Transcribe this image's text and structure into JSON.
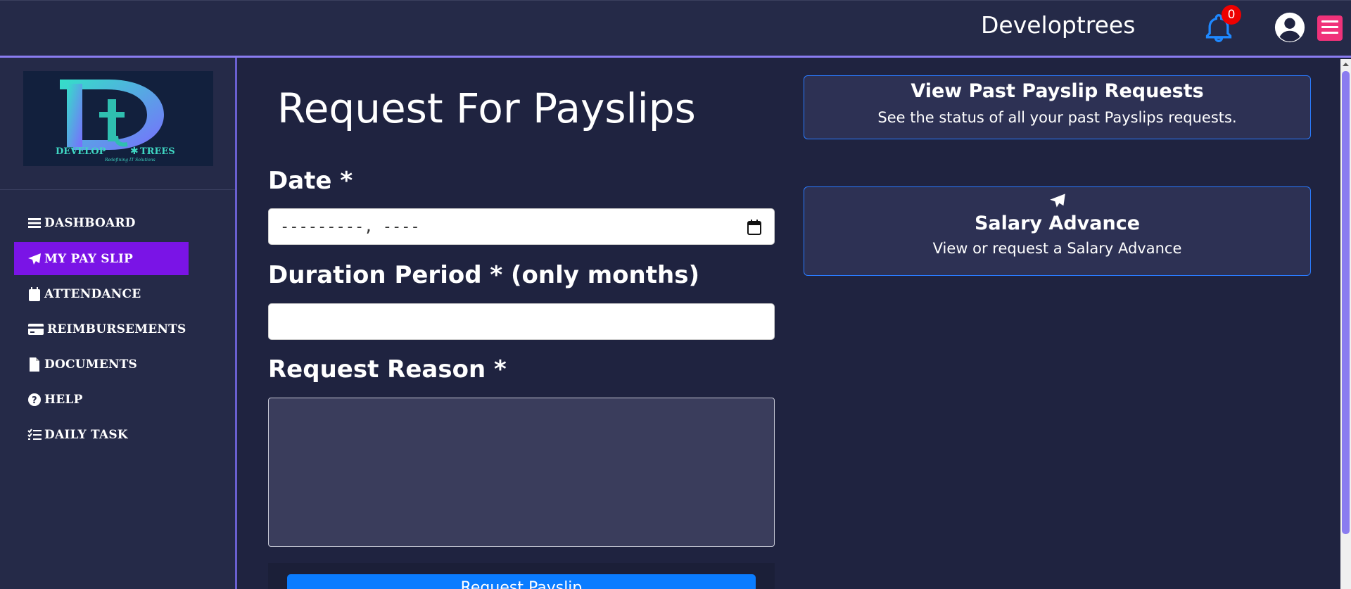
{
  "header": {
    "brand": "Developtrees",
    "notification_count": "0"
  },
  "sidebar": {
    "logo_text": "DEVELOPTREES",
    "logo_tagline": "Redefining IT Solutions",
    "items": [
      {
        "label": "DASHBOARD",
        "icon": "bars-icon"
      },
      {
        "label": "MY PAY SLIP",
        "icon": "paper-plane-icon",
        "active": true
      },
      {
        "label": "ATTENDANCE",
        "icon": "calendar-icon"
      },
      {
        "label": "REIMBURSEMENTS",
        "icon": "credit-card-icon"
      },
      {
        "label": "DOCUMENTS",
        "icon": "file-icon"
      },
      {
        "label": "HELP",
        "icon": "question-circle-icon"
      },
      {
        "label": "DAILY TASK",
        "icon": "list-check-icon"
      }
    ]
  },
  "main": {
    "title": "Request For Payslips",
    "date_label": "Date *",
    "date_placeholder": "---------, ----",
    "duration_label": "Duration Period * (only months)",
    "duration_value": "",
    "reason_label": "Request Reason *",
    "reason_value": "",
    "submit_label": "Request Payslip"
  },
  "cards": {
    "past": {
      "title": "View Past Payslip Requests",
      "desc": "See the status of all your past Payslips requests."
    },
    "advance": {
      "title": "Salary Advance",
      "desc": "View or request a Salary Advance"
    }
  },
  "colors": {
    "background": "#1f2340",
    "panel": "#252a48",
    "accent": "#7a14e6",
    "card_border": "#2a7bff",
    "button": "#0a7cff",
    "menu": "#f0327a",
    "bell": "#1e88ff",
    "badge": "#ee0000"
  }
}
